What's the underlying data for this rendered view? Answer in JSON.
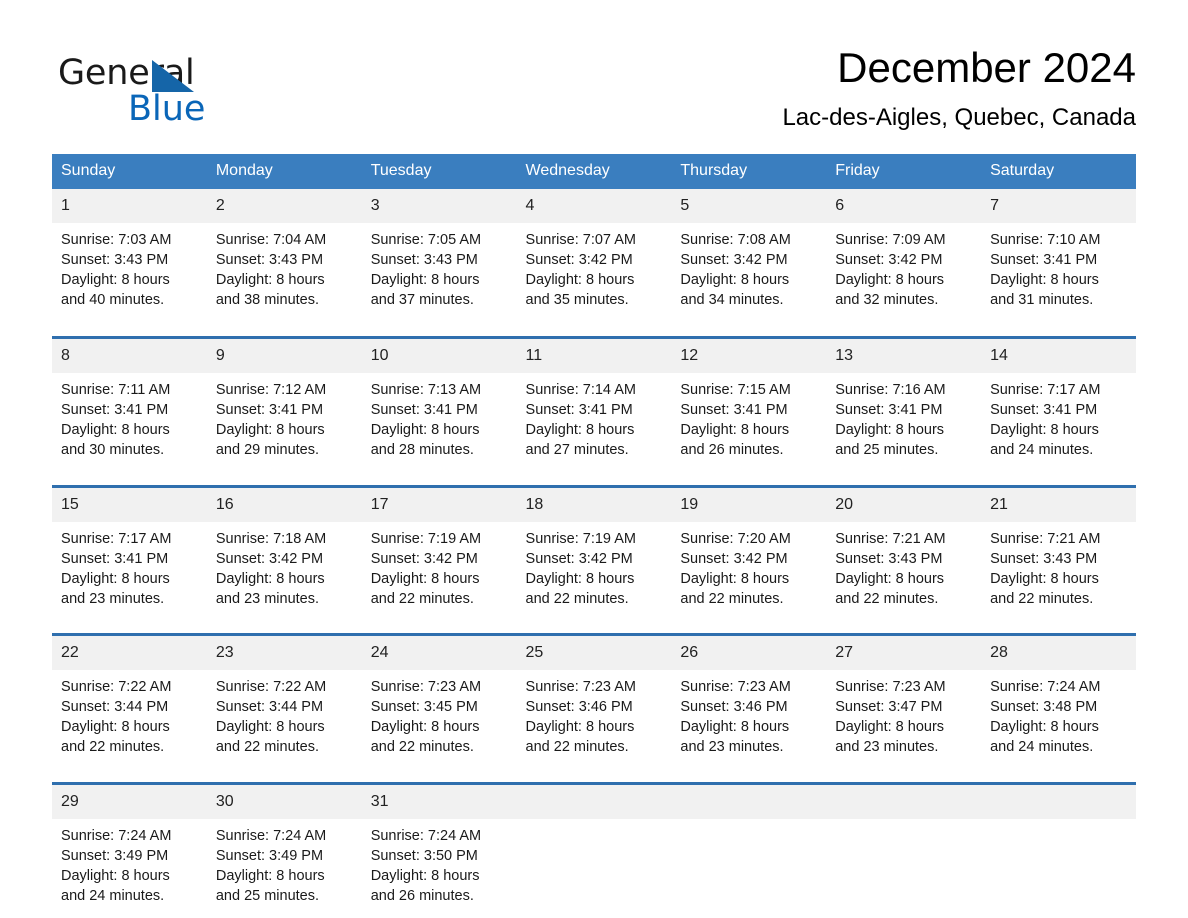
{
  "brand": {
    "name_part1": "General",
    "name_part2": "Blue",
    "triangle_color": "#1565a8",
    "blue_text_color": "#0a66b8"
  },
  "header": {
    "title": "December 2024",
    "subtitle": "Lac-des-Aigles, Quebec, Canada"
  },
  "theme": {
    "header_row_bg": "#3a7ebf",
    "row_divider": "#2f6fae",
    "daynum_bg": "#f1f1f1",
    "page_bg": "#ffffff"
  },
  "calendar": {
    "weekday_headers": [
      "Sunday",
      "Monday",
      "Tuesday",
      "Wednesday",
      "Thursday",
      "Friday",
      "Saturday"
    ],
    "weeks": [
      [
        {
          "day": "1",
          "info": "Sunrise: 7:03 AM\nSunset: 3:43 PM\nDaylight: 8 hours\nand 40 minutes."
        },
        {
          "day": "2",
          "info": "Sunrise: 7:04 AM\nSunset: 3:43 PM\nDaylight: 8 hours\nand 38 minutes."
        },
        {
          "day": "3",
          "info": "Sunrise: 7:05 AM\nSunset: 3:43 PM\nDaylight: 8 hours\nand 37 minutes."
        },
        {
          "day": "4",
          "info": "Sunrise: 7:07 AM\nSunset: 3:42 PM\nDaylight: 8 hours\nand 35 minutes."
        },
        {
          "day": "5",
          "info": "Sunrise: 7:08 AM\nSunset: 3:42 PM\nDaylight: 8 hours\nand 34 minutes."
        },
        {
          "day": "6",
          "info": "Sunrise: 7:09 AM\nSunset: 3:42 PM\nDaylight: 8 hours\nand 32 minutes."
        },
        {
          "day": "7",
          "info": "Sunrise: 7:10 AM\nSunset: 3:41 PM\nDaylight: 8 hours\nand 31 minutes."
        }
      ],
      [
        {
          "day": "8",
          "info": "Sunrise: 7:11 AM\nSunset: 3:41 PM\nDaylight: 8 hours\nand 30 minutes."
        },
        {
          "day": "9",
          "info": "Sunrise: 7:12 AM\nSunset: 3:41 PM\nDaylight: 8 hours\nand 29 minutes."
        },
        {
          "day": "10",
          "info": "Sunrise: 7:13 AM\nSunset: 3:41 PM\nDaylight: 8 hours\nand 28 minutes."
        },
        {
          "day": "11",
          "info": "Sunrise: 7:14 AM\nSunset: 3:41 PM\nDaylight: 8 hours\nand 27 minutes."
        },
        {
          "day": "12",
          "info": "Sunrise: 7:15 AM\nSunset: 3:41 PM\nDaylight: 8 hours\nand 26 minutes."
        },
        {
          "day": "13",
          "info": "Sunrise: 7:16 AM\nSunset: 3:41 PM\nDaylight: 8 hours\nand 25 minutes."
        },
        {
          "day": "14",
          "info": "Sunrise: 7:17 AM\nSunset: 3:41 PM\nDaylight: 8 hours\nand 24 minutes."
        }
      ],
      [
        {
          "day": "15",
          "info": "Sunrise: 7:17 AM\nSunset: 3:41 PM\nDaylight: 8 hours\nand 23 minutes."
        },
        {
          "day": "16",
          "info": "Sunrise: 7:18 AM\nSunset: 3:42 PM\nDaylight: 8 hours\nand 23 minutes."
        },
        {
          "day": "17",
          "info": "Sunrise: 7:19 AM\nSunset: 3:42 PM\nDaylight: 8 hours\nand 22 minutes."
        },
        {
          "day": "18",
          "info": "Sunrise: 7:19 AM\nSunset: 3:42 PM\nDaylight: 8 hours\nand 22 minutes."
        },
        {
          "day": "19",
          "info": "Sunrise: 7:20 AM\nSunset: 3:42 PM\nDaylight: 8 hours\nand 22 minutes."
        },
        {
          "day": "20",
          "info": "Sunrise: 7:21 AM\nSunset: 3:43 PM\nDaylight: 8 hours\nand 22 minutes."
        },
        {
          "day": "21",
          "info": "Sunrise: 7:21 AM\nSunset: 3:43 PM\nDaylight: 8 hours\nand 22 minutes."
        }
      ],
      [
        {
          "day": "22",
          "info": "Sunrise: 7:22 AM\nSunset: 3:44 PM\nDaylight: 8 hours\nand 22 minutes."
        },
        {
          "day": "23",
          "info": "Sunrise: 7:22 AM\nSunset: 3:44 PM\nDaylight: 8 hours\nand 22 minutes."
        },
        {
          "day": "24",
          "info": "Sunrise: 7:23 AM\nSunset: 3:45 PM\nDaylight: 8 hours\nand 22 minutes."
        },
        {
          "day": "25",
          "info": "Sunrise: 7:23 AM\nSunset: 3:46 PM\nDaylight: 8 hours\nand 22 minutes."
        },
        {
          "day": "26",
          "info": "Sunrise: 7:23 AM\nSunset: 3:46 PM\nDaylight: 8 hours\nand 23 minutes."
        },
        {
          "day": "27",
          "info": "Sunrise: 7:23 AM\nSunset: 3:47 PM\nDaylight: 8 hours\nand 23 minutes."
        },
        {
          "day": "28",
          "info": "Sunrise: 7:24 AM\nSunset: 3:48 PM\nDaylight: 8 hours\nand 24 minutes."
        }
      ],
      [
        {
          "day": "29",
          "info": "Sunrise: 7:24 AM\nSunset: 3:49 PM\nDaylight: 8 hours\nand 24 minutes."
        },
        {
          "day": "30",
          "info": "Sunrise: 7:24 AM\nSunset: 3:49 PM\nDaylight: 8 hours\nand 25 minutes."
        },
        {
          "day": "31",
          "info": "Sunrise: 7:24 AM\nSunset: 3:50 PM\nDaylight: 8 hours\nand 26 minutes."
        },
        {
          "day": "",
          "info": ""
        },
        {
          "day": "",
          "info": ""
        },
        {
          "day": "",
          "info": ""
        },
        {
          "day": "",
          "info": ""
        }
      ]
    ]
  }
}
